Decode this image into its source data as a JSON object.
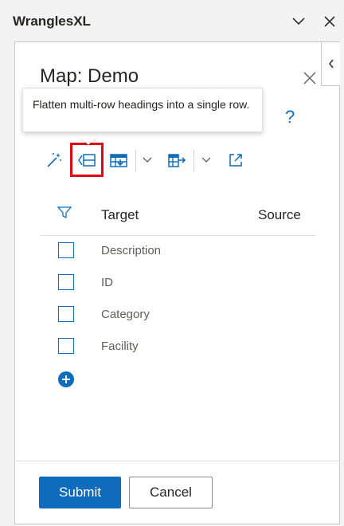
{
  "pane": {
    "title": "WranglesXL",
    "icons": {
      "dropdown": "chevron-down-icon",
      "close": "close-icon"
    }
  },
  "panel": {
    "title": "Map: Demo",
    "help_symbol": "?",
    "tooltip": "Flatten multi-row headings into a single row."
  },
  "toolbar": {
    "items": [
      {
        "name": "magic-wand-icon"
      },
      {
        "name": "flatten-headings-icon",
        "highlighted": true
      },
      {
        "name": "table-download-icon"
      },
      {
        "name": "chevron-down-icon"
      },
      {
        "name": "table-map-icon"
      },
      {
        "name": "chevron-down-icon"
      },
      {
        "name": "expand-icon"
      }
    ]
  },
  "table": {
    "columns": [
      "Target",
      "Source"
    ],
    "rows": [
      {
        "label": "Description",
        "checked": false
      },
      {
        "label": "ID",
        "checked": false
      },
      {
        "label": "Category",
        "checked": false
      },
      {
        "label": "Facility",
        "checked": false
      }
    ]
  },
  "actions": {
    "submit": "Submit",
    "cancel": "Cancel"
  },
  "colors": {
    "accent": "#0f6cbd",
    "highlight": "#e30613",
    "border": "#c8c6c4"
  }
}
